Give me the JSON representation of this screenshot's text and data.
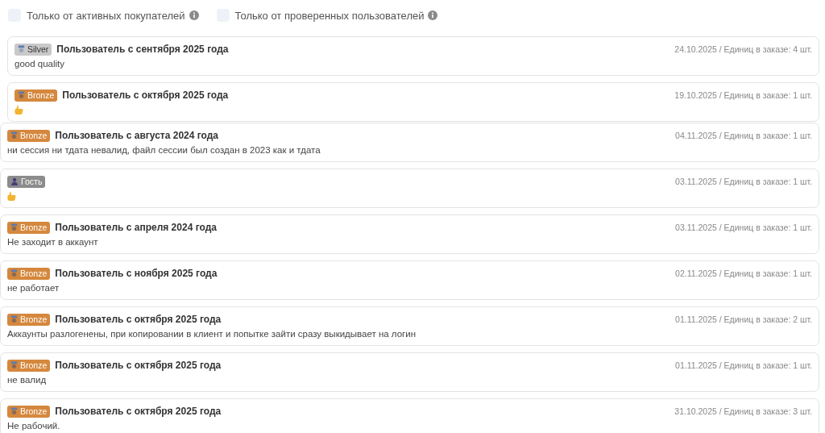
{
  "filters": [
    {
      "label": "Только от активных покупателей",
      "checked": false
    },
    {
      "label": "Только от проверенных пользователей",
      "checked": false
    }
  ],
  "reviews": [
    {
      "shifted": true,
      "badge": {
        "kind": "silver",
        "label": "Silver"
      },
      "author": "Пользователь с сентября 2025 года",
      "meta": "24.10.2025 / Единиц в заказе: 4 шт.",
      "body": {
        "kind": "text",
        "text": "good quality"
      }
    },
    {
      "shifted": true,
      "badge": {
        "kind": "bronze",
        "label": "Bronze"
      },
      "author": "Пользователь с октября 2025 года",
      "meta": "19.10.2025 / Единиц в заказе: 1 шт.",
      "body": {
        "kind": "thumb"
      }
    },
    {
      "shifted": false,
      "badge": {
        "kind": "bronze",
        "label": "Bronze"
      },
      "author": "Пользователь с августа 2024 года",
      "meta": "04.11.2025 / Единиц в заказе: 1 шт.",
      "body": {
        "kind": "text",
        "text": "ни сессия ни тдата невалид, файл сессии был создан в 2023 как и тдата"
      }
    },
    {
      "shifted": false,
      "badge": {
        "kind": "guest",
        "label": "Гость"
      },
      "meta": "03.11.2025 / Единиц в заказе: 1 шт.",
      "body": {
        "kind": "thumb"
      }
    },
    {
      "shifted": false,
      "badge": {
        "kind": "bronze",
        "label": "Bronze"
      },
      "author": "Пользователь с апреля 2024 года",
      "meta": "03.11.2025 / Единиц в заказе: 1 шт.",
      "body": {
        "kind": "text",
        "text": "Не заходит в аккаунт"
      }
    },
    {
      "shifted": false,
      "badge": {
        "kind": "bronze",
        "label": "Bronze"
      },
      "author": "Пользователь с ноября 2025 года",
      "meta": "02.11.2025 / Единиц в заказе: 1 шт.",
      "body": {
        "kind": "text",
        "text": "не работает"
      }
    },
    {
      "shifted": false,
      "badge": {
        "kind": "bronze",
        "label": "Bronze"
      },
      "author": "Пользователь с октября 2025 года",
      "meta": "01.11.2025 / Единиц в заказе: 2 шт.",
      "body": {
        "kind": "text",
        "text": "Аккаунты разлогенены, при копировании в клиент и попытке зайти сразу выкидывает на логин"
      }
    },
    {
      "shifted": false,
      "badge": {
        "kind": "bronze",
        "label": "Bronze"
      },
      "author": "Пользователь с октября 2025 года",
      "meta": "01.11.2025 / Единиц в заказе: 1 шт.",
      "body": {
        "kind": "text",
        "text": "не валид"
      }
    },
    {
      "shifted": false,
      "badge": {
        "kind": "bronze",
        "label": "Bronze"
      },
      "author": "Пользователь с октября 2025 года",
      "meta": "31.10.2025 / Единиц в заказе: 3 шт.",
      "body": {
        "kind": "text",
        "text": "Не рабочий."
      }
    }
  ]
}
